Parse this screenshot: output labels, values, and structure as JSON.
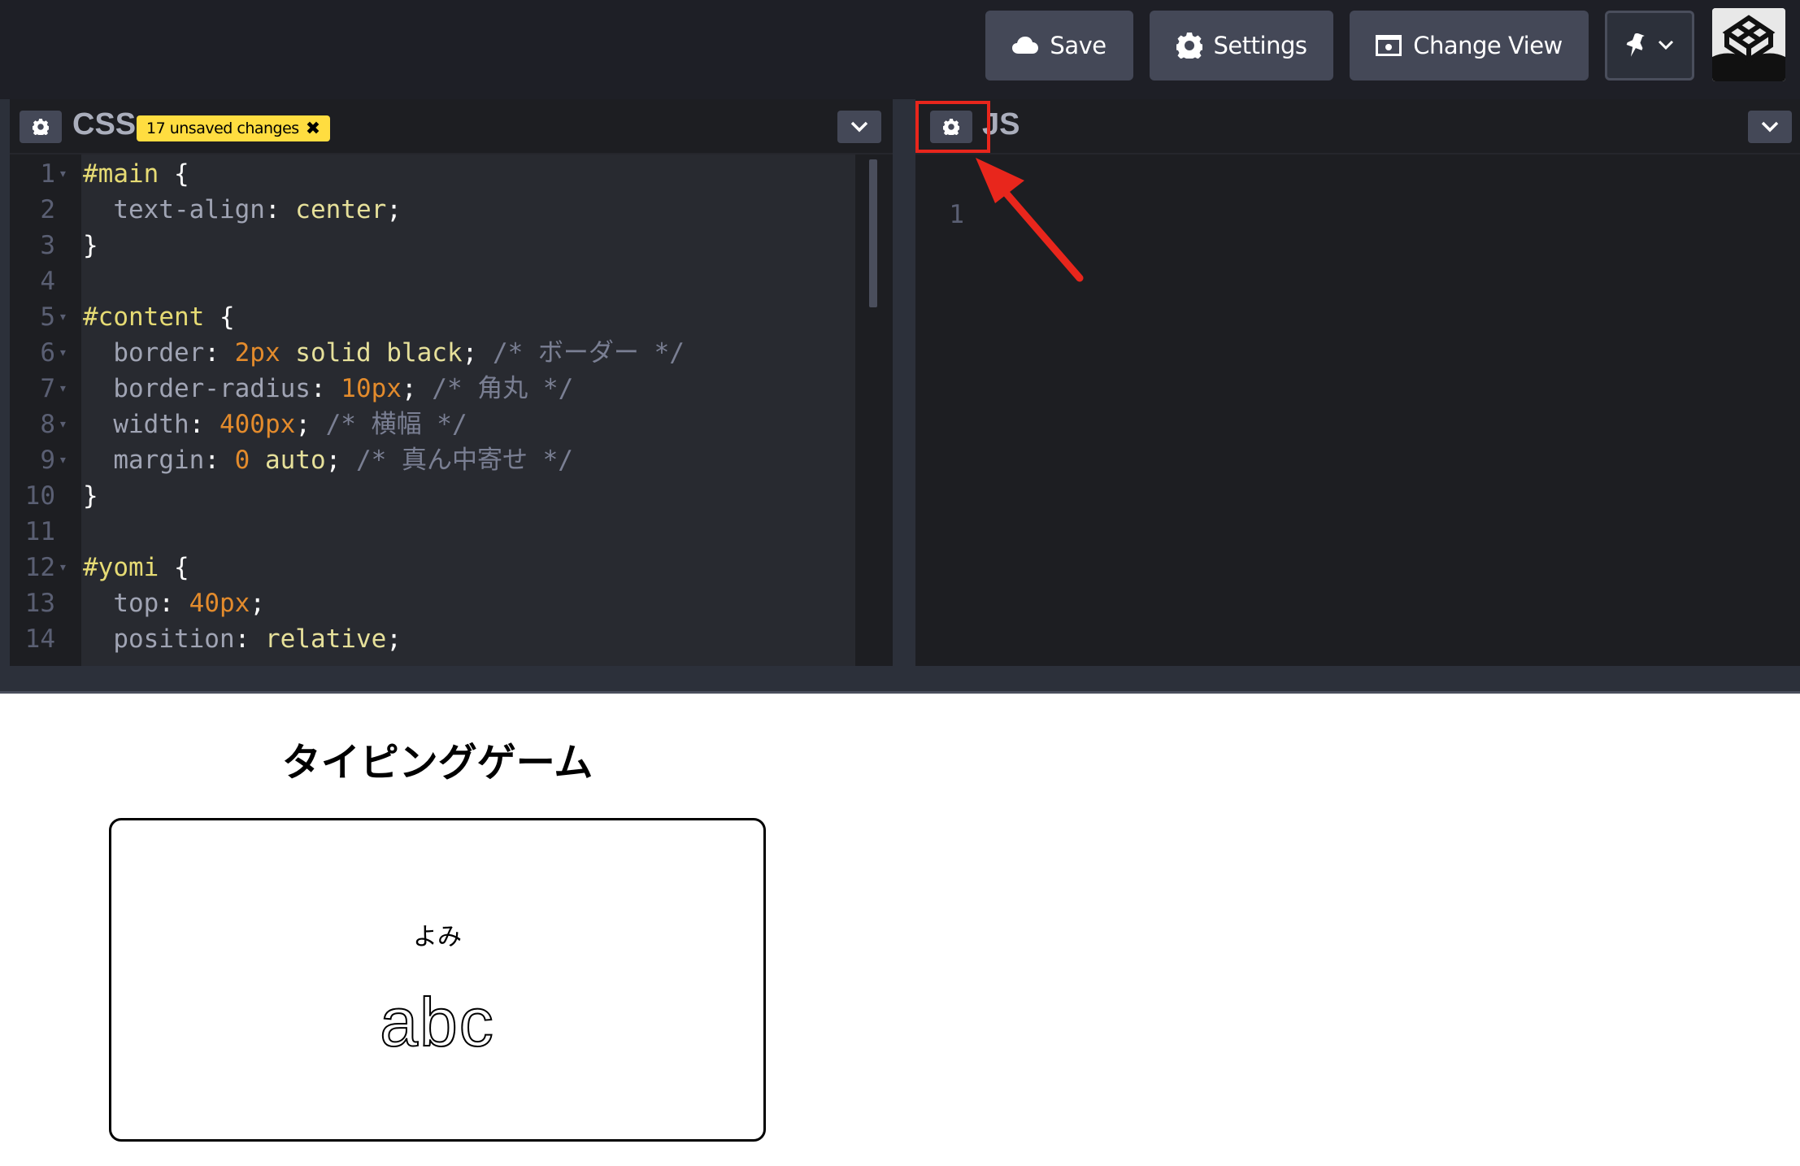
{
  "header": {
    "save_label": "Save",
    "settings_label": "Settings",
    "change_view_label": "Change View"
  },
  "css_panel": {
    "title": "CSS",
    "badge": "17 unsaved changes",
    "badge_close": "✖",
    "lines": [
      {
        "n": "1",
        "fold": true,
        "parts": [
          [
            "sel",
            "#main"
          ],
          [
            "pun",
            " {"
          ]
        ]
      },
      {
        "n": "2",
        "fold": false,
        "parts": [
          [
            "prop",
            "  text-align"
          ],
          [
            "pun",
            ": "
          ],
          [
            "val",
            "center"
          ],
          [
            "pun",
            ";"
          ]
        ]
      },
      {
        "n": "3",
        "fold": false,
        "parts": [
          [
            "pun",
            "}"
          ]
        ]
      },
      {
        "n": "4",
        "fold": false,
        "parts": []
      },
      {
        "n": "5",
        "fold": true,
        "parts": [
          [
            "sel",
            "#content"
          ],
          [
            "pun",
            " {"
          ]
        ]
      },
      {
        "n": "6",
        "fold": true,
        "parts": [
          [
            "prop",
            "  border"
          ],
          [
            "pun",
            ": "
          ],
          [
            "num",
            "2px"
          ],
          [
            "val",
            " solid black"
          ],
          [
            "pun",
            "; "
          ],
          [
            "cmt",
            "/* ボーダー */"
          ]
        ]
      },
      {
        "n": "7",
        "fold": true,
        "parts": [
          [
            "prop",
            "  border-radius"
          ],
          [
            "pun",
            ": "
          ],
          [
            "num",
            "10px"
          ],
          [
            "pun",
            "; "
          ],
          [
            "cmt",
            "/* 角丸 */"
          ]
        ]
      },
      {
        "n": "8",
        "fold": true,
        "parts": [
          [
            "prop",
            "  width"
          ],
          [
            "pun",
            ": "
          ],
          [
            "num",
            "400px"
          ],
          [
            "pun",
            "; "
          ],
          [
            "cmt",
            "/* 横幅 */"
          ]
        ]
      },
      {
        "n": "9",
        "fold": true,
        "parts": [
          [
            "prop",
            "  margin"
          ],
          [
            "pun",
            ": "
          ],
          [
            "num",
            "0"
          ],
          [
            "val",
            " auto"
          ],
          [
            "pun",
            "; "
          ],
          [
            "cmt",
            "/* 真ん中寄せ */"
          ]
        ]
      },
      {
        "n": "10",
        "fold": false,
        "parts": [
          [
            "pun",
            "}"
          ]
        ]
      },
      {
        "n": "11",
        "fold": false,
        "parts": []
      },
      {
        "n": "12",
        "fold": true,
        "parts": [
          [
            "sel",
            "#yomi"
          ],
          [
            "pun",
            " {"
          ]
        ]
      },
      {
        "n": "13",
        "fold": false,
        "parts": [
          [
            "prop",
            "  top"
          ],
          [
            "pun",
            ": "
          ],
          [
            "num",
            "40px"
          ],
          [
            "pun",
            ";"
          ]
        ]
      },
      {
        "n": "14",
        "fold": false,
        "parts": [
          [
            "prop",
            "  position"
          ],
          [
            "pun",
            ": "
          ],
          [
            "val",
            "relative"
          ],
          [
            "pun",
            ";"
          ]
        ]
      }
    ]
  },
  "js_panel": {
    "title": "JS",
    "lines": [
      {
        "n": "1"
      }
    ]
  },
  "preview": {
    "title": "タイピングゲーム",
    "yomi": "よみ",
    "word": "abc"
  },
  "colors": {
    "annotation": "#e8261c",
    "badge": "#ffdd40",
    "header_bg": "#1e1f26"
  },
  "icons": {
    "save": "cloud-icon",
    "settings": "gear-icon",
    "change_view": "window-icon",
    "pin": "pin-icon"
  }
}
